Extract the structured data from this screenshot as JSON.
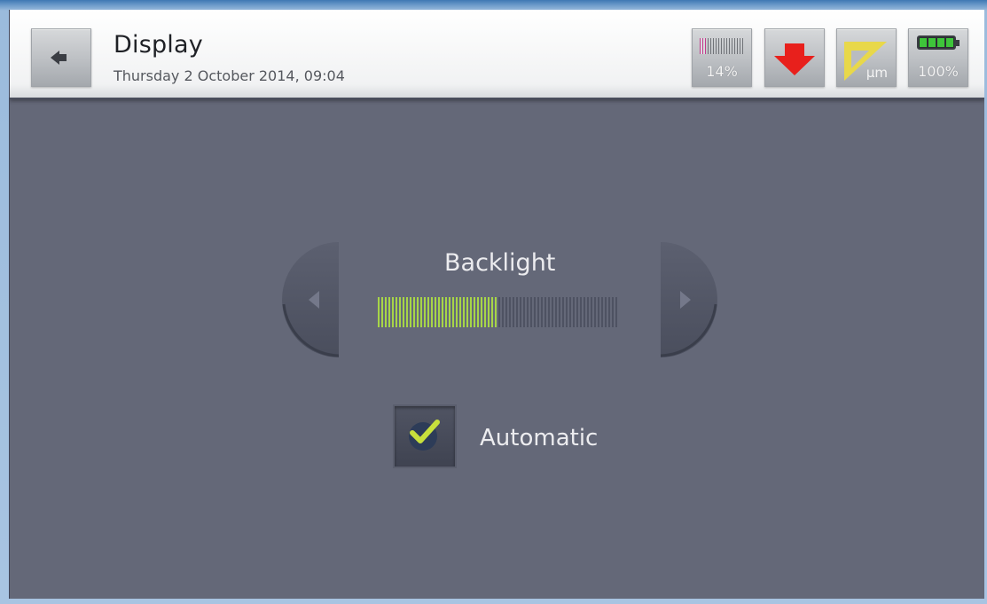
{
  "header": {
    "title": "Display",
    "datetime": "Thursday 2 October 2014, 09:04",
    "back_icon": "back-arrow-icon"
  },
  "status": {
    "storage": {
      "label": "14%",
      "fraction": 0.14,
      "icon": "storage-bars-icon",
      "color": "#c23a8b"
    },
    "download": {
      "icon": "download-arrow-icon",
      "color": "#e8201c"
    },
    "unit": {
      "label": "µm",
      "icon": "ruler-triangle-icon",
      "color": "#e8d84a"
    },
    "battery": {
      "label": "100%",
      "fraction": 1.0,
      "icon": "battery-icon",
      "color": "#3ec53a"
    }
  },
  "backlight": {
    "title": "Backlight",
    "level": 0.5,
    "fill_color": "#a7d548",
    "prev_icon": "chevron-left-icon",
    "next_icon": "chevron-right-icon"
  },
  "automatic": {
    "label": "Automatic",
    "checked": true,
    "check_color": "#c8e03c"
  }
}
